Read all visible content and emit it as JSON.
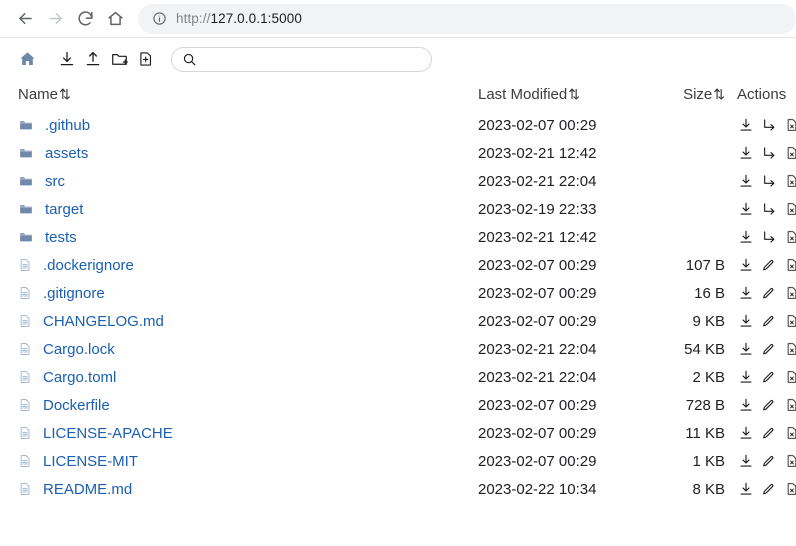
{
  "browser": {
    "back_label": "Back",
    "forward_label": "Forward",
    "reload_label": "Reload",
    "home_label": "Home",
    "url_scheme": "http://",
    "url_host": "127.0.0.1:5000",
    "site_info_label": "View site information"
  },
  "toolbar": {
    "home_label": "Home directory",
    "download_label": "Download",
    "upload_label": "Upload",
    "new_folder_label": "New folder",
    "new_file_label": "New file",
    "search_placeholder": "",
    "search_value": ""
  },
  "table": {
    "headers": {
      "name": "Name",
      "last_modified": "Last Modified",
      "size": "Size",
      "actions": "Actions"
    },
    "sort_icon": "⇅",
    "rows": [
      {
        "type": "folder",
        "name": ".github",
        "modified": "2023-02-07 00:29",
        "size": "",
        "actions": [
          "download",
          "move",
          "delete"
        ]
      },
      {
        "type": "folder",
        "name": "assets",
        "modified": "2023-02-21 12:42",
        "size": "",
        "actions": [
          "download",
          "move",
          "delete"
        ]
      },
      {
        "type": "folder",
        "name": "src",
        "modified": "2023-02-21 22:04",
        "size": "",
        "actions": [
          "download",
          "move",
          "delete"
        ]
      },
      {
        "type": "folder",
        "name": "target",
        "modified": "2023-02-19 22:33",
        "size": "",
        "actions": [
          "download",
          "move",
          "delete"
        ]
      },
      {
        "type": "folder",
        "name": "tests",
        "modified": "2023-02-21 12:42",
        "size": "",
        "actions": [
          "download",
          "move",
          "delete"
        ]
      },
      {
        "type": "file",
        "name": ".dockerignore",
        "modified": "2023-02-07 00:29",
        "size": "107 B",
        "actions": [
          "download",
          "edit",
          "delete"
        ]
      },
      {
        "type": "file",
        "name": ".gitignore",
        "modified": "2023-02-07 00:29",
        "size": "16 B",
        "actions": [
          "download",
          "edit",
          "delete"
        ]
      },
      {
        "type": "file",
        "name": "CHANGELOG.md",
        "modified": "2023-02-07 00:29",
        "size": "9 KB",
        "actions": [
          "download",
          "edit",
          "delete"
        ]
      },
      {
        "type": "file",
        "name": "Cargo.lock",
        "modified": "2023-02-21 22:04",
        "size": "54 KB",
        "actions": [
          "download",
          "edit",
          "delete"
        ]
      },
      {
        "type": "file",
        "name": "Cargo.toml",
        "modified": "2023-02-21 22:04",
        "size": "2 KB",
        "actions": [
          "download",
          "edit",
          "delete"
        ]
      },
      {
        "type": "file",
        "name": "Dockerfile",
        "modified": "2023-02-07 00:29",
        "size": "728 B",
        "actions": [
          "download",
          "edit",
          "delete"
        ]
      },
      {
        "type": "file",
        "name": "LICENSE-APACHE",
        "modified": "2023-02-07 00:29",
        "size": "11 KB",
        "actions": [
          "download",
          "edit",
          "delete"
        ]
      },
      {
        "type": "file",
        "name": "LICENSE-MIT",
        "modified": "2023-02-07 00:29",
        "size": "1 KB",
        "actions": [
          "download",
          "edit",
          "delete"
        ]
      },
      {
        "type": "file",
        "name": "README.md",
        "modified": "2023-02-22 10:34",
        "size": "8 KB",
        "actions": [
          "download",
          "edit",
          "delete"
        ]
      }
    ]
  },
  "colors": {
    "link": "#1a5fb4",
    "folder_icon": "#6f87a8",
    "file_icon": "#9bb0cc",
    "url_bar_bg": "#f1f3f4",
    "chrome_icon": "#5f6368"
  }
}
